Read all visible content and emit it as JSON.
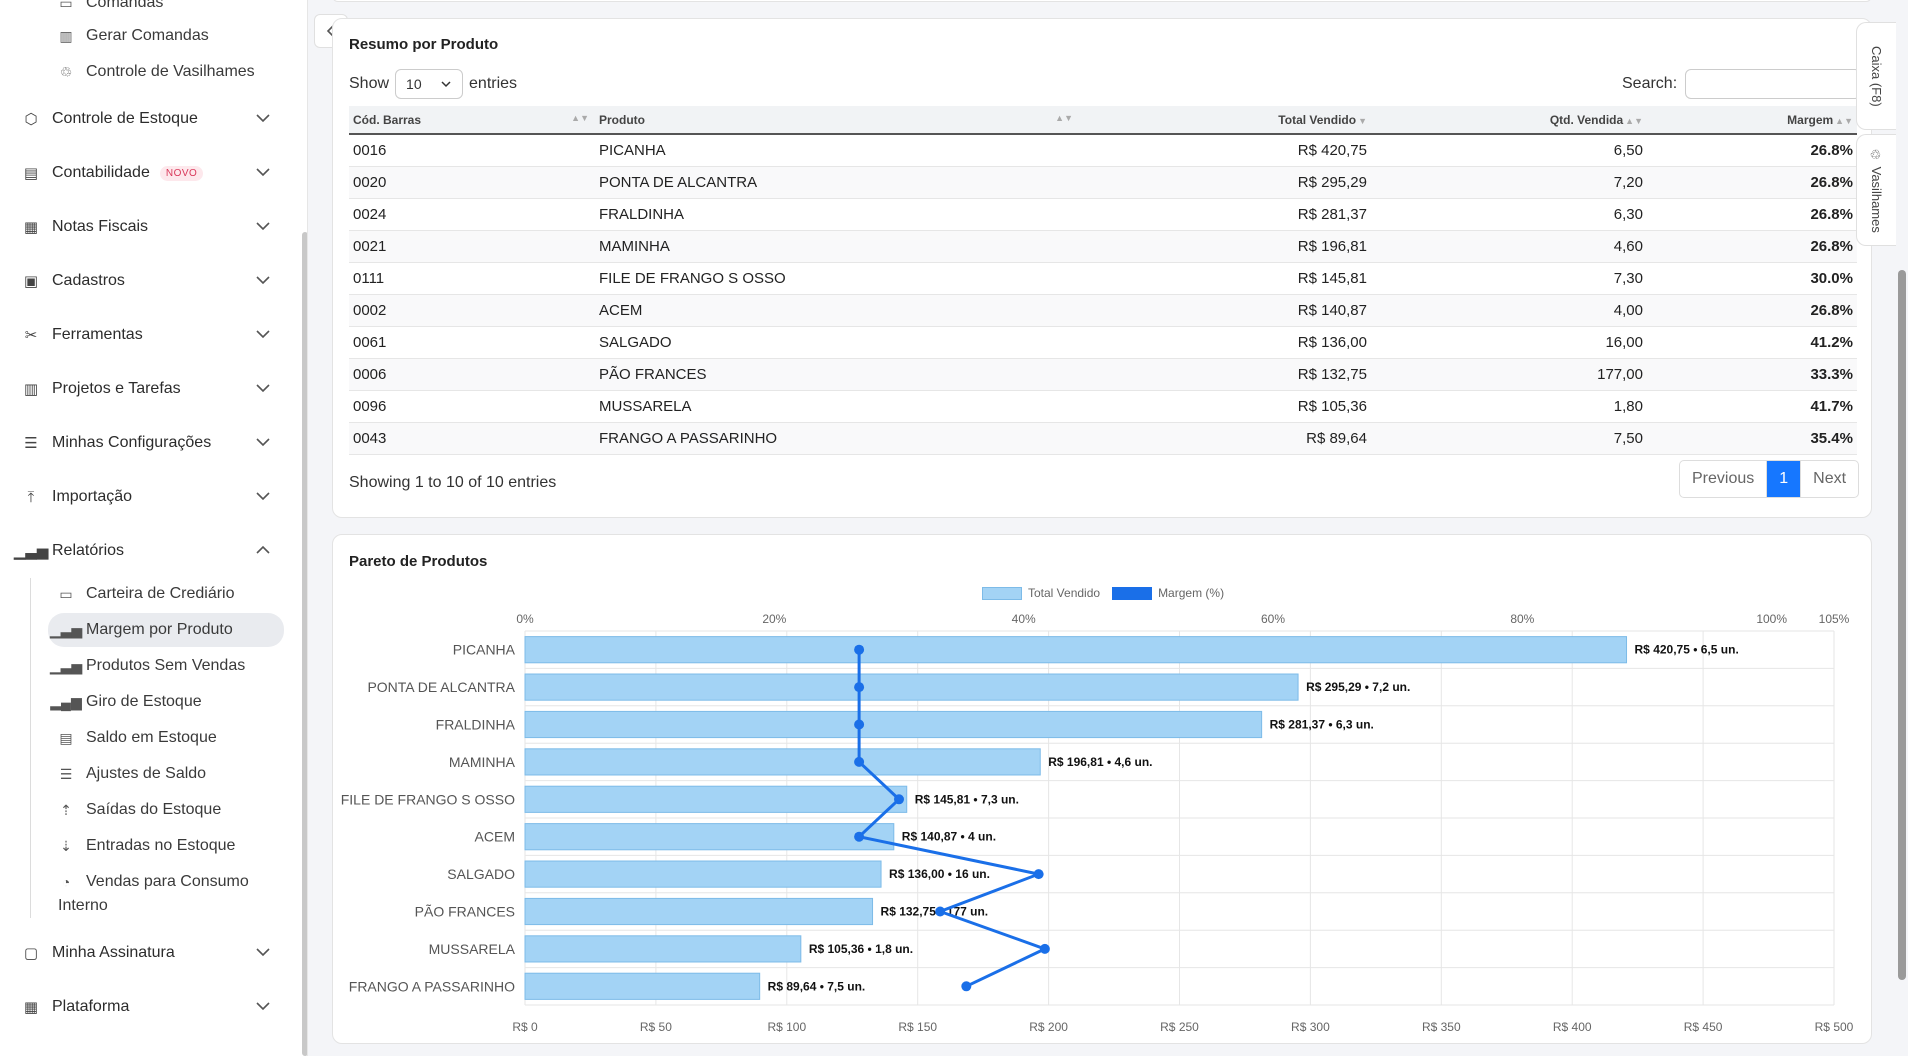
{
  "sidebar": {
    "top_items": [
      {
        "label": "Comandas",
        "icon": "receipt-icon"
      },
      {
        "label": "Gerar Comandas",
        "icon": "barcode-icon"
      },
      {
        "label": "Controle de Vasilhames",
        "icon": "recycle-icon"
      }
    ],
    "menu": [
      {
        "label": "Controle de Estoque",
        "icon": "box-icon"
      },
      {
        "label": "Contabilidade",
        "icon": "ledger-icon",
        "badge": "NOVO"
      },
      {
        "label": "Notas Fiscais",
        "icon": "invoice-icon"
      },
      {
        "label": "Cadastros",
        "icon": "form-icon"
      },
      {
        "label": "Ferramentas",
        "icon": "tools-icon"
      },
      {
        "label": "Projetos e Tarefas",
        "icon": "kanban-icon"
      },
      {
        "label": "Minhas Configurações",
        "icon": "sliders-icon"
      },
      {
        "label": "Importação",
        "icon": "upload-icon"
      },
      {
        "label": "Relatórios",
        "icon": "bar-chart-icon"
      }
    ],
    "reports": [
      {
        "label": "Carteira de Crediário",
        "icon": "wallet-icon"
      },
      {
        "label": "Margem por Produto",
        "icon": "bar-chart-icon",
        "active": true
      },
      {
        "label": "Produtos Sem Vendas",
        "icon": "bar-chart-icon"
      },
      {
        "label": "Giro de Estoque",
        "icon": "bar-chart-filled-icon"
      },
      {
        "label": "Saldo em Estoque",
        "icon": "card-list-icon"
      },
      {
        "label": "Ajustes de Saldo",
        "icon": "sliders-icon"
      },
      {
        "label": "Saídas do Estoque",
        "icon": "box-out-icon"
      },
      {
        "label": "Entradas no Estoque",
        "icon": "box-in-icon"
      },
      {
        "label": "Vendas para Consumo",
        "label2": "Interno",
        "icon": "bag-icon"
      }
    ],
    "bottom": [
      {
        "label": "Minha Assinatura",
        "icon": "subscription-icon"
      },
      {
        "label": "Plataforma",
        "icon": "grid-icon"
      }
    ]
  },
  "summary": {
    "title": "Resumo por Produto",
    "show_label": "Show",
    "entries_label": "entries",
    "page_size": "10",
    "search_label": "Search:",
    "columns": [
      "Cód. Barras",
      "Produto",
      "Total Vendido",
      "Qtd. Vendida",
      "Margem"
    ],
    "rows": [
      [
        "0016",
        "PICANHA",
        "R$ 420,75",
        "6,50",
        "26.8%"
      ],
      [
        "0020",
        "PONTA DE ALCANTRA",
        "R$ 295,29",
        "7,20",
        "26.8%"
      ],
      [
        "0024",
        "FRALDINHA",
        "R$ 281,37",
        "6,30",
        "26.8%"
      ],
      [
        "0021",
        "MAMINHA",
        "R$ 196,81",
        "4,60",
        "26.8%"
      ],
      [
        "0111",
        "FILE DE FRANGO S OSSO",
        "R$ 145,81",
        "7,30",
        "30.0%"
      ],
      [
        "0002",
        "ACEM",
        "R$ 140,87",
        "4,00",
        "26.8%"
      ],
      [
        "0061",
        "SALGADO",
        "R$ 136,00",
        "16,00",
        "41.2%"
      ],
      [
        "0006",
        "PÃO FRANCES",
        "R$ 132,75",
        "177,00",
        "33.3%"
      ],
      [
        "0096",
        "MUSSARELA",
        "R$ 105,36",
        "1,80",
        "41.7%"
      ],
      [
        "0043",
        "FRANGO A PASSARINHO",
        "R$ 89,64",
        "7,50",
        "35.4%"
      ]
    ],
    "footer": "Showing 1 to 10 of 10 entries",
    "pager": {
      "previous": "Previous",
      "current": "1",
      "next": "Next"
    }
  },
  "pareto": {
    "title": "Pareto de Produtos"
  },
  "chart_data": {
    "type": "bar",
    "orientation": "horizontal",
    "categories": [
      "PICANHA",
      "PONTA DE ALCANTRA",
      "FRALDINHA",
      "MAMINHA",
      "FILE DE FRANGO S OSSO",
      "ACEM",
      "SALGADO",
      "PÃO FRANCES",
      "MUSSARELA",
      "FRANGO A PASSARINHO"
    ],
    "series": [
      {
        "name": "Total Vendido",
        "type": "bar",
        "values": [
          420.75,
          295.29,
          281.37,
          196.81,
          145.81,
          140.87,
          136.0,
          132.75,
          105.36,
          89.64
        ],
        "color": "#a3d3f5"
      },
      {
        "name": "Margem (%)",
        "type": "line",
        "values": [
          26.8,
          26.8,
          26.8,
          26.8,
          30.0,
          26.8,
          41.2,
          33.3,
          41.7,
          35.4
        ],
        "color": "#1a6fe8"
      }
    ],
    "bar_labels": [
      "R$ 420,75 • 6,5 un.",
      "R$ 295,29 • 7,2 un.",
      "R$ 281,37 • 6,3 un.",
      "R$ 196,81 • 4,6 un.",
      "R$ 145,81 • 7,3 un.",
      "R$ 140,87 • 4 un.",
      "R$ 136,00 • 16 un.",
      "R$ 132,75 • 177 un.",
      "R$ 105,36 • 1,8 un.",
      "R$ 89,64 • 7,5 un."
    ],
    "x_bottom": {
      "ticks": [
        "R$ 0",
        "R$ 50",
        "R$ 100",
        "R$ 150",
        "R$ 200",
        "R$ 250",
        "R$ 300",
        "R$ 350",
        "R$ 400",
        "R$ 450",
        "R$ 500"
      ],
      "range": [
        0,
        500
      ]
    },
    "x_top": {
      "ticks": [
        "0%",
        "20%",
        "40%",
        "60%",
        "80%",
        "100%",
        "105%"
      ],
      "tick_values": [
        0,
        20,
        40,
        60,
        80,
        100,
        105
      ],
      "range": [
        0,
        105
      ]
    },
    "legend": "top-center",
    "grid": true
  },
  "float_tabs": [
    {
      "label": "Caixa (F8)"
    },
    {
      "label": "Vasilhames",
      "icon": "recycle-icon"
    }
  ],
  "colors": {
    "accent": "#1677ff",
    "margin_text": "#1a7f37",
    "bar_fill": "#a3d3f5",
    "line": "#1a6fe8"
  }
}
